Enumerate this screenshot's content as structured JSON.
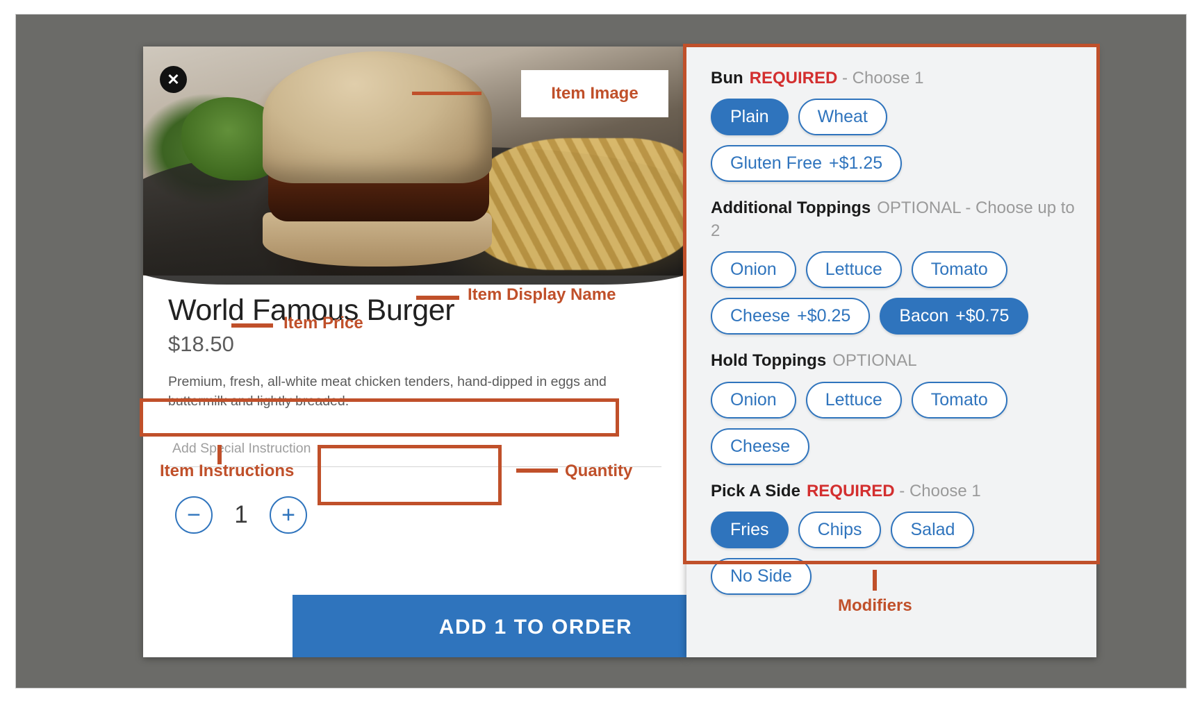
{
  "item": {
    "close_icon": "close-icon",
    "name": "World Famous Burger",
    "price": "$18.50",
    "description": "Premium, fresh, all-white meat chicken tenders, hand-dipped in eggs and buttermilk and lightly breaded.",
    "special_instruction_placeholder": "Add Special Instruction",
    "special_instruction_value": "",
    "quantity": "1",
    "decrease_label": "−",
    "increase_label": "+",
    "add_to_order_label": "ADD 1 TO ORDER"
  },
  "modifiers": {
    "groups": [
      {
        "name": "Bun",
        "requirement": "REQUIRED",
        "requirement_type": "required",
        "rule": "- Choose 1",
        "options": [
          {
            "label": "Plain",
            "price": "",
            "selected": true
          },
          {
            "label": "Wheat",
            "price": "",
            "selected": false
          },
          {
            "label": "Gluten Free",
            "price": "+$1.25",
            "selected": false
          }
        ]
      },
      {
        "name": "Additional Toppings",
        "requirement": "OPTIONAL",
        "requirement_type": "optional",
        "rule": "- Choose up to 2",
        "options": [
          {
            "label": "Onion",
            "price": "",
            "selected": false
          },
          {
            "label": "Lettuce",
            "price": "",
            "selected": false
          },
          {
            "label": "Tomato",
            "price": "",
            "selected": false
          },
          {
            "label": "Cheese",
            "price": "+$0.25",
            "selected": false
          },
          {
            "label": "Bacon",
            "price": "+$0.75",
            "selected": true
          }
        ]
      },
      {
        "name": "Hold Toppings",
        "requirement": "OPTIONAL",
        "requirement_type": "optional",
        "rule": "",
        "options": [
          {
            "label": "Onion",
            "price": "",
            "selected": false
          },
          {
            "label": "Lettuce",
            "price": "",
            "selected": false
          },
          {
            "label": "Tomato",
            "price": "",
            "selected": false
          },
          {
            "label": "Cheese",
            "price": "",
            "selected": false
          }
        ]
      },
      {
        "name": "Pick A Side",
        "requirement": "REQUIRED",
        "requirement_type": "required",
        "rule": "- Choose 1",
        "options": [
          {
            "label": "Fries",
            "price": "",
            "selected": true
          },
          {
            "label": "Chips",
            "price": "",
            "selected": false
          },
          {
            "label": "Salad",
            "price": "",
            "selected": false
          },
          {
            "label": "No Side",
            "price": "",
            "selected": false
          }
        ]
      }
    ]
  },
  "annotations": {
    "item_image": "Item Image",
    "item_display_name": "Item Display Name",
    "item_price": "Item Price",
    "item_instructions": "Item Instructions",
    "quantity": "Quantity",
    "modifiers": "Modifiers"
  },
  "colors": {
    "accent_blue": "#2f74bd",
    "annotation_orange": "#c0502a",
    "required_red": "#d32f2f",
    "optional_gray": "#9a9a9a",
    "panel_background": "#f2f3f4",
    "backdrop_gray": "#6b6b68"
  }
}
